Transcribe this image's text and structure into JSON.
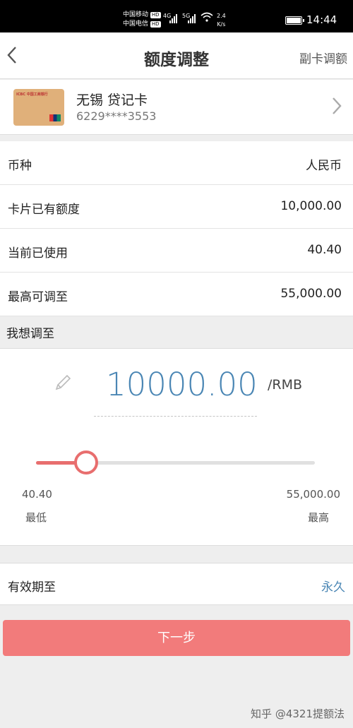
{
  "status_bar": {
    "carrier1": "中国移动",
    "carrier2": "中国电信",
    "hd": "HD",
    "net1": "4G",
    "net2": "5G",
    "speed_value": "2.4",
    "speed_unit": "K/s",
    "time": "14:44"
  },
  "nav": {
    "title": "额度调整",
    "right_action": "副卡调额"
  },
  "card": {
    "name": "无锡 贷记卡",
    "number": "6229****3553",
    "thumb_logo": "ICBC 中国工商银行"
  },
  "rows": [
    {
      "label": "币种",
      "value": "人民币"
    },
    {
      "label": "卡片已有额度",
      "value": "10,000.00"
    },
    {
      "label": "当前已使用",
      "value": "40.40"
    },
    {
      "label": "最高可调至",
      "value": "55,000.00"
    }
  ],
  "adjust": {
    "section_label": "我想调至",
    "amount": "10000.00",
    "unit": "/RMB",
    "slider_min_value": "40.40",
    "slider_min_label": "最低",
    "slider_max_value": "55,000.00",
    "slider_max_label": "最高",
    "slider_fraction": 0.18
  },
  "validity": {
    "label": "有效期至",
    "value": "永久"
  },
  "next_button": "下一步",
  "watermark": "知乎 @4321提额法",
  "colors": {
    "accent": "#f27b7b",
    "amount": "#4a86b4"
  }
}
